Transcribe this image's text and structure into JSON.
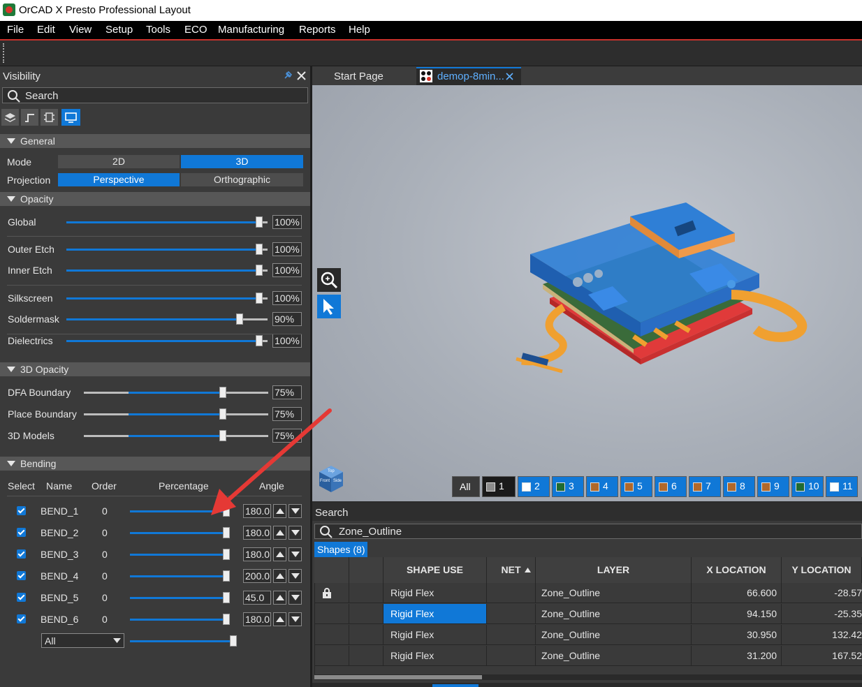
{
  "app": {
    "title": "OrCAD X Presto Professional Layout"
  },
  "menu": [
    "File",
    "Edit",
    "View",
    "Setup",
    "Tools",
    "ECO",
    "Manufacturing",
    "Reports",
    "Help"
  ],
  "visibility": {
    "title": "Visibility",
    "search_placeholder": "Search",
    "general": {
      "label": "General",
      "mode_label": "Mode",
      "mode_2d": "2D",
      "mode_3d": "3D",
      "projection_label": "Projection",
      "perspective": "Perspective",
      "orthographic": "Orthographic",
      "active_mode": "3D",
      "active_projection": "Perspective"
    },
    "opacity": {
      "label": "Opacity",
      "rows": [
        {
          "label": "Global",
          "value": "100%",
          "level": 1.0
        },
        {
          "label": "Outer Etch",
          "value": "100%",
          "level": 1.0
        },
        {
          "label": "Inner Etch",
          "value": "100%",
          "level": 1.0
        },
        {
          "label": "Silkscreen",
          "value": "100%",
          "level": 1.0
        },
        {
          "label": "Soldermask",
          "value": "90%",
          "level": 0.9
        },
        {
          "label": "Dielectrics",
          "value": "100%",
          "level": 1.0
        }
      ]
    },
    "opacity3d": {
      "label": "3D Opacity",
      "rows": [
        {
          "label": "DFA Boundary",
          "value": "75%",
          "level": 0.75
        },
        {
          "label": "Place Boundary",
          "value": "75%",
          "level": 0.75
        },
        {
          "label": "3D Models",
          "value": "75%",
          "level": 0.75
        }
      ]
    },
    "bending": {
      "label": "Bending",
      "headers": {
        "select": "Select",
        "name": "Name",
        "order": "Order",
        "percentage": "Percentage",
        "angle": "Angle"
      },
      "rows": [
        {
          "name": "BEND_1",
          "order": "0",
          "angle": "180.0",
          "level": 1.0
        },
        {
          "name": "BEND_2",
          "order": "0",
          "angle": "180.0",
          "level": 1.0
        },
        {
          "name": "BEND_3",
          "order": "0",
          "angle": "180.0",
          "level": 1.0
        },
        {
          "name": "BEND_4",
          "order": "0",
          "angle": "200.0",
          "level": 1.0
        },
        {
          "name": "BEND_5",
          "order": "0",
          "angle": "45.0",
          "level": 1.0
        },
        {
          "name": "BEND_6",
          "order": "0",
          "angle": "180.0",
          "level": 1.0
        }
      ],
      "all_option": "All"
    }
  },
  "tabs": [
    {
      "label": "Start Page",
      "active": false
    },
    {
      "label": "demop-8min...",
      "active": true
    }
  ],
  "layers": {
    "all_label": "All",
    "buttons": [
      {
        "num": "1",
        "color": "#8c8c8c"
      },
      {
        "num": "2",
        "color": "#ffffff"
      },
      {
        "num": "3",
        "color": "#1f6b32"
      },
      {
        "num": "4",
        "color": "#b0682a"
      },
      {
        "num": "5",
        "color": "#b0682a"
      },
      {
        "num": "6",
        "color": "#b0682a"
      },
      {
        "num": "7",
        "color": "#b0682a"
      },
      {
        "num": "8",
        "color": "#b0682a"
      },
      {
        "num": "9",
        "color": "#b0682a"
      },
      {
        "num": "10",
        "color": "#1f6b32"
      },
      {
        "num": "11",
        "color": "#ffffff"
      }
    ]
  },
  "search_panel": {
    "title": "Search",
    "query": "Zone_Outline",
    "results_tab": "Shapes (8)",
    "columns": [
      "SHAPE USE",
      "NET",
      "LAYER",
      "X LOCATION",
      "Y LOCATION"
    ],
    "rows": [
      {
        "shape_use": "Rigid Flex",
        "net": "",
        "layer": "Zone_Outline",
        "x": "66.600",
        "y": "-28.57",
        "locked": true,
        "selected": false
      },
      {
        "shape_use": "Rigid Flex",
        "net": "",
        "layer": "Zone_Outline",
        "x": "94.150",
        "y": "-25.35",
        "locked": false,
        "selected": true
      },
      {
        "shape_use": "Rigid Flex",
        "net": "",
        "layer": "Zone_Outline",
        "x": "30.950",
        "y": "132.42",
        "locked": false,
        "selected": false
      },
      {
        "shape_use": "Rigid Flex",
        "net": "",
        "layer": "Zone_Outline",
        "x": "31.200",
        "y": "167.52",
        "locked": false,
        "selected": false
      }
    ]
  },
  "viewcube": {
    "top": "Top",
    "front": "Front",
    "side": "Side"
  },
  "colors": {
    "accent": "#1078d7",
    "annotation_arrow": "#e53935"
  }
}
